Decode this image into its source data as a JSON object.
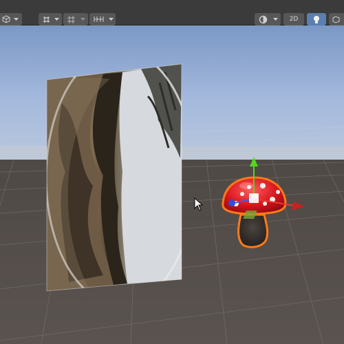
{
  "toolbar": {
    "label_2d": "2D",
    "icons": [
      "cube-icon",
      "dropdown-arrow-icon",
      "transform-tools-icon",
      "grid-snapping-icon",
      "increment-snap-icon",
      "shading-mode-icon",
      "2d-toggle",
      "lighting-toggle-icon",
      "more-icon"
    ],
    "accent_color": "#5a7fb0"
  },
  "scene": {
    "sky_color": "#9ab3d8",
    "ground_color": "#564f4b",
    "selection_outline_color": "#ff7a1a",
    "gizmo_colors": {
      "y": "#53d81e",
      "x": "#e83a2f",
      "z": "#3b5de7"
    }
  }
}
